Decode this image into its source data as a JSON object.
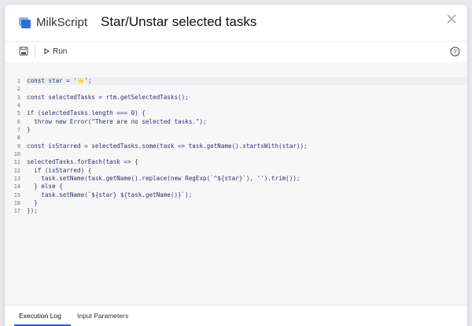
{
  "header": {
    "brand": "MilkScript",
    "title": "Star/Unstar selected tasks"
  },
  "toolbar": {
    "run_label": "Run"
  },
  "editor": {
    "lines": [
      "const star = '⭐';",
      "",
      "const selectedTasks = rtm.getSelectedTasks();",
      "",
      "if (selectedTasks.length === 0) {",
      "  throw new Error(\"There are no selected tasks.\");",
      "}",
      "",
      "const isStarred = selectedTasks.some(task => task.getName().startsWith(star));",
      "",
      "selectedTasks.forEach(task => {",
      "  if (isStarred) {",
      "    task.setName(task.getName().replace(new RegExp(`^${star}`), '').trim());",
      "  } else {",
      "    task.setName(`${star} ${task.getName()}`);",
      "  }",
      "});"
    ],
    "line_numbers": [
      "1",
      "2",
      "3",
      "4",
      "5",
      "6",
      "7",
      "8",
      "9",
      "10",
      "11",
      "12",
      "13",
      "14",
      "15",
      "16",
      "17"
    ]
  },
  "footer": {
    "tabs": [
      "Execution Log",
      "Input Parameters"
    ],
    "active_tab": "Execution Log"
  },
  "colors": {
    "accent": "#2a5bd7",
    "keyword": "#1a2fa0",
    "string": "#b3222a",
    "number": "#1b7a3a"
  }
}
